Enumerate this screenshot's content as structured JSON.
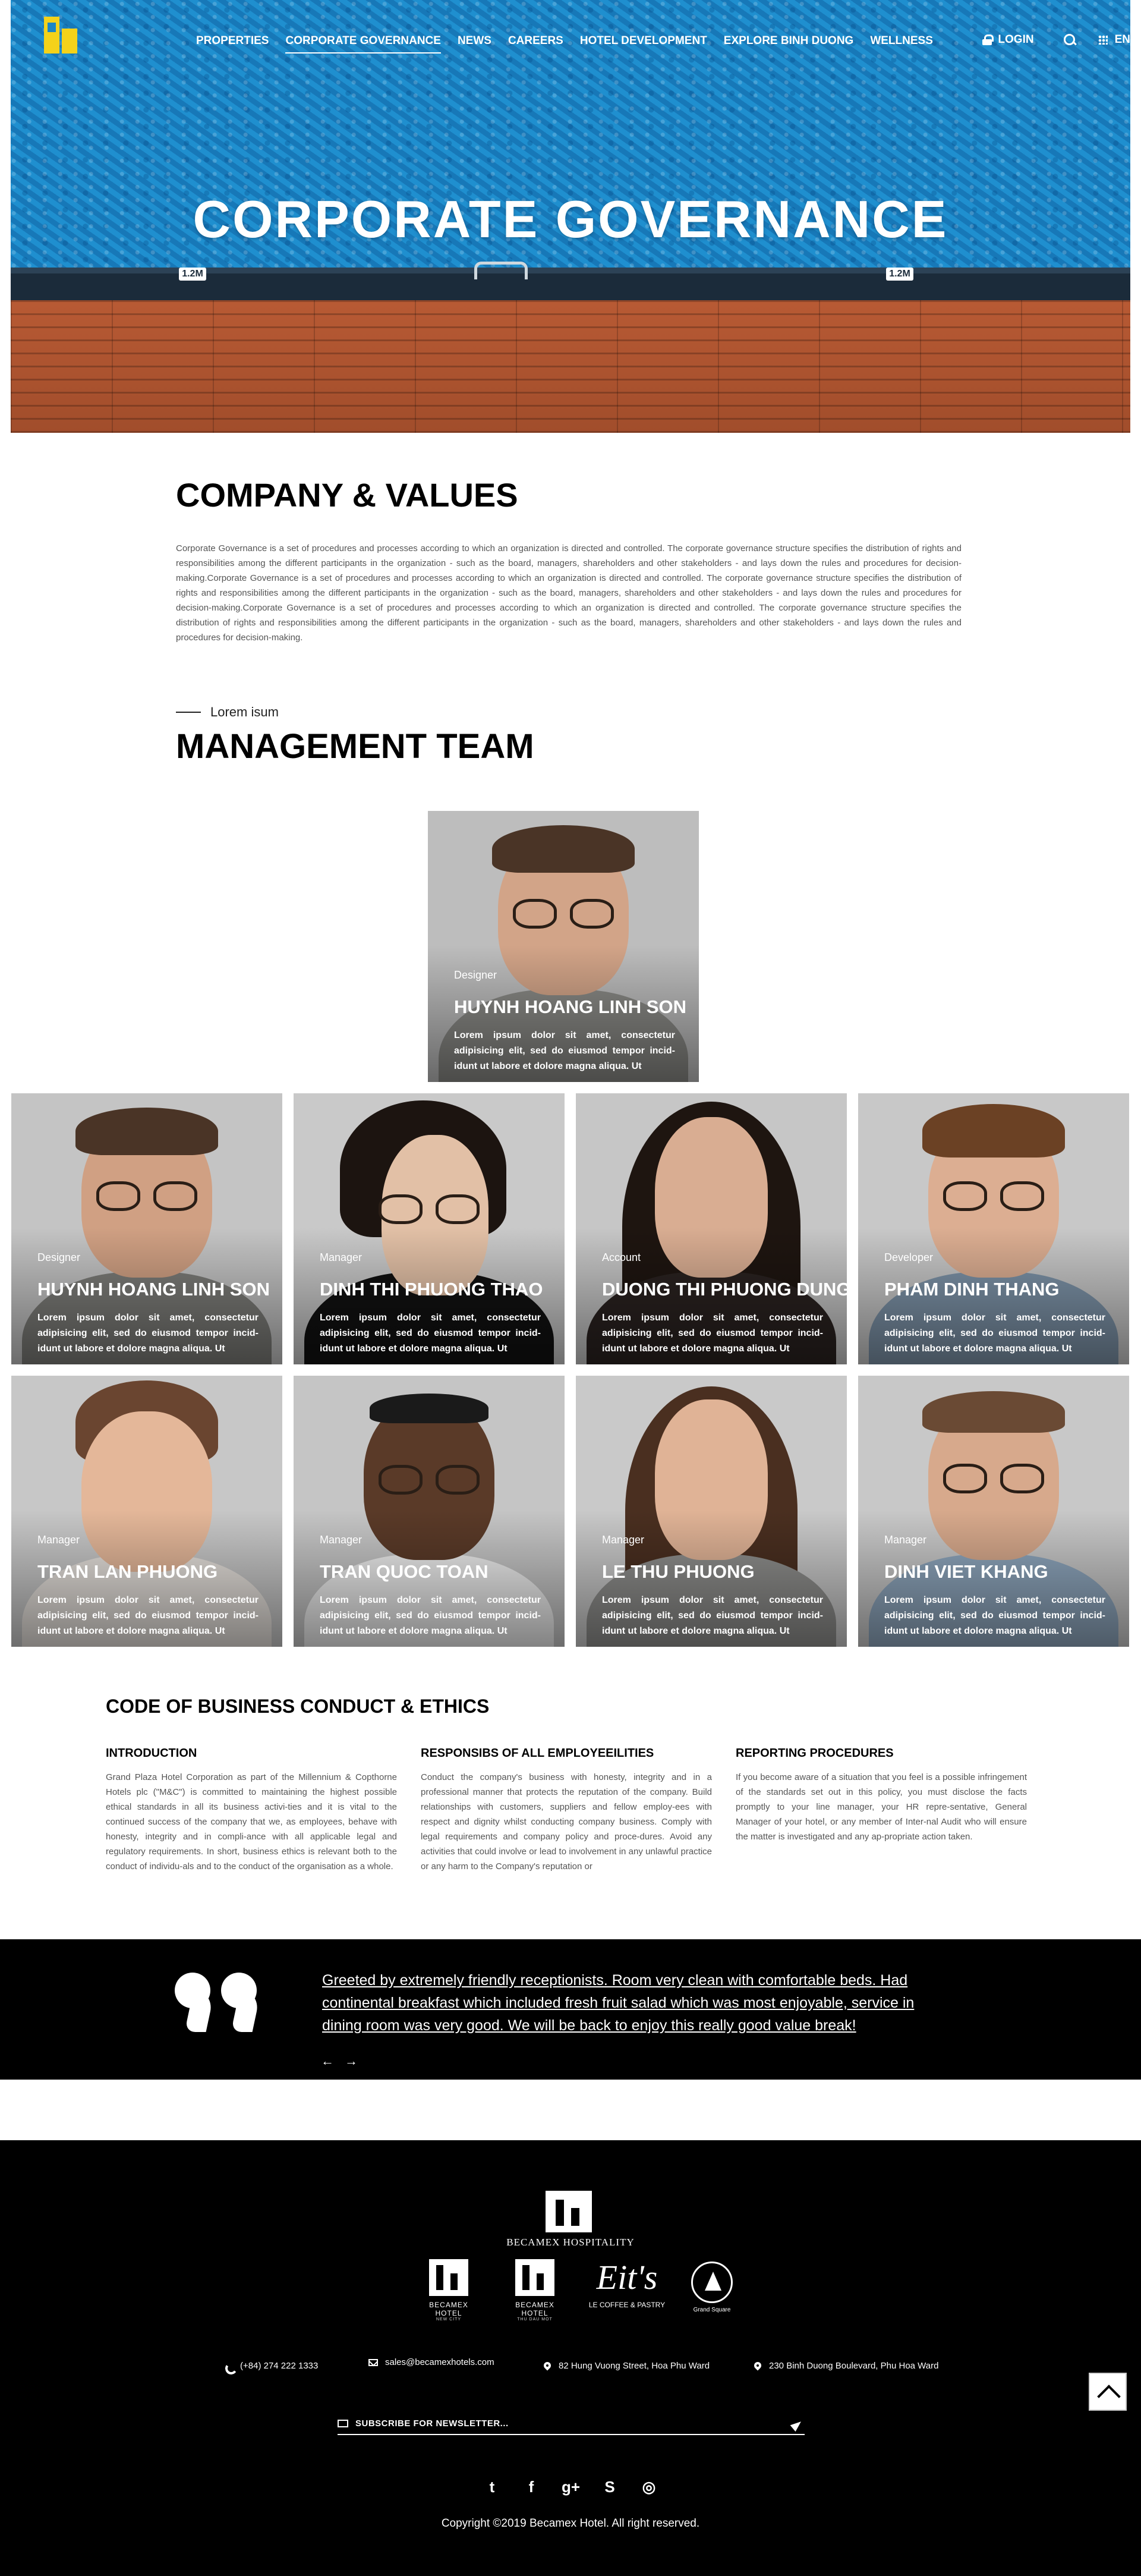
{
  "nav": {
    "items": [
      {
        "label": "PROPERTIES",
        "active": false
      },
      {
        "label": "CORPORATE GOVERNANCE",
        "active": true
      },
      {
        "label": "NEWS",
        "active": false
      },
      {
        "label": "CAREERS",
        "active": false
      },
      {
        "label": "HOTEL DEVELOPMENT",
        "active": false
      },
      {
        "label": "EXPLORE BINH DUONG",
        "active": false
      },
      {
        "label": "WELLNESS",
        "active": false
      }
    ],
    "login": "LOGIN",
    "lang": "EN",
    "icons": [
      "lock-icon",
      "search-icon",
      "grid-icon"
    ]
  },
  "hero": {
    "title": "CORPORATE GOVERNANCE",
    "depth_markers": [
      "1.2M",
      "1.2M"
    ]
  },
  "company": {
    "title": "COMPANY & VALUES",
    "text": "Corporate Governance is a set of procedures and processes according to which an organization is directed and controlled. The corporate governance structure specifies the distribution of rights and responsibilities among the different participants in the organization - such as the board, managers, shareholders and other stakeholders - and lays down the rules and procedures for decision-making.Corporate Governance is a set of procedures and processes according to which an organization is directed and controlled. The corporate governance structure specifies the distribution of rights and responsibilities among the different participants in the organization - such as the board, managers, shareholders and other stakeholders - and lays down the rules and procedures for decision-making.Corporate Governance is a set of procedures and processes according to which an organization is directed and controlled. The corporate governance structure specifies the distribution of rights and responsibilities among the different participants in the organization - such as the board, managers, shareholders and other stakeholders - and lays down the rules and procedures for decision-making."
  },
  "management": {
    "lead": "Lorem isum",
    "title": "MANAGEMENT TEAM",
    "featured": {
      "role": "Designer",
      "name": "HUYNH HOANG LINH SON",
      "desc": "Lorem ipsum dolor sit amet, consectetur adipisicing elit, sed do eiusmod tempor incid-idunt ut labore et dolore magna aliqua. Ut"
    },
    "members": [
      {
        "role": "Designer",
        "name": "HUYNH HOANG LINH SON",
        "desc": "Lorem ipsum dolor sit amet, consectetur adipisicing elit, sed do eiusmod tempor incid-idunt ut labore et dolore magna aliqua. Ut"
      },
      {
        "role": "Manager",
        "name": "DINH THI PHUONG THAO",
        "desc": "Lorem ipsum dolor sit amet, consectetur adipisicing elit, sed do eiusmod tempor incid-idunt ut labore et dolore magna aliqua. Ut"
      },
      {
        "role": "Account",
        "name": "DUONG THI PHUONG DUNG",
        "desc": "Lorem ipsum dolor sit amet, consectetur adipisicing elit, sed do eiusmod tempor incid-idunt ut labore et dolore magna aliqua. Ut"
      },
      {
        "role": "Developer",
        "name": "PHAM DINH THANG",
        "desc": "Lorem ipsum dolor sit amet, consectetur adipisicing elit, sed do eiusmod tempor incid-idunt ut labore et dolore magna aliqua. Ut"
      },
      {
        "role": "Manager",
        "name": "TRAN LAN PHUONG",
        "desc": "Lorem ipsum dolor sit amet, consectetur adipisicing elit, sed do eiusmod tempor incid-idunt ut labore et dolore magna aliqua. Ut"
      },
      {
        "role": "Manager",
        "name": "TRAN QUOC TOAN",
        "desc": "Lorem ipsum dolor sit amet, consectetur adipisicing elit, sed do eiusmod tempor incid-idunt ut labore et dolore magna aliqua. Ut"
      },
      {
        "role": "Manager",
        "name": "LE THU PHUONG",
        "desc": "Lorem ipsum dolor sit amet, consectetur adipisicing elit, sed do eiusmod tempor incid-idunt ut labore et dolore magna aliqua. Ut"
      },
      {
        "role": "Manager",
        "name": "DINH VIET KHANG",
        "desc": "Lorem ipsum dolor sit amet, consectetur adipisicing elit, sed do eiusmod tempor incid-idunt ut labore et dolore magna aliqua. Ut"
      }
    ]
  },
  "code": {
    "title": "CODE OF BUSINESS CONDUCT & ETHICS",
    "columns": [
      {
        "heading": "INTRODUCTION",
        "text": "Grand Plaza Hotel Corporation as part of the Millennium & Copthorne Hotels plc (\"M&C\") is committed to maintaining the highest possible ethical standards in all its business activi-ties and it is vital to the continued success of the company that we, as employees, behave with honesty, integrity and in compli-ance with all applicable legal and regulatory requirements. In short, business ethics is relevant both to the conduct of individu-als and to the conduct of the organisation as a whole."
      },
      {
        "heading": "RESPONSIBS OF ALL EMPLOYEEILITIES",
        "text": "Conduct the company's business with honesty, integrity and in a professional manner that protects the reputation of the company. Build relationships with customers, suppliers and fellow employ-ees with respect and dignity whilst conducting company business. Comply with legal requirements and company policy and proce-dures. Avoid any activities that could involve or lead to involvement in any unlawful practice or any harm to the Company's reputation or"
      },
      {
        "heading": "REPORTING PROCEDURES",
        "text": "If you become aware of a situation that you feel is a possible infringement of the standards set out in this policy, you must disclose the facts promptly to your line manager, your HR repre-sentative, General Manager of your hotel, or any member of Inter-nal Audit who will ensure the matter is investigated and any ap-propriate action taken."
      }
    ]
  },
  "testimonial": {
    "quote": "Greeted by extremely friendly receptionists. Room very clean with comfortable beds. Had continental breakfast which included fresh fruit salad which was most enjoyable, service in dining room was very good. We will be back to enjoy this really good value break!",
    "prev": "←",
    "next": "→"
  },
  "footer": {
    "brand": "BECAMEX HOSPITALITY",
    "sub_brands": [
      {
        "name": "BECAMEX HOTEL",
        "sub": "NEW CITY"
      },
      {
        "name": "BECAMEX HOTEL",
        "sub": "THU DAU MOT"
      },
      {
        "name": "LE COFFEE & PASTRY",
        "script": "Eit's"
      },
      {
        "name": "Grand Square",
        "sub": ""
      }
    ],
    "contacts": [
      {
        "icon": "phone-icon",
        "text": "(+84) 274 222 1333"
      },
      {
        "icon": "mail-icon",
        "text": "sales@becamexhotels.com"
      },
      {
        "icon": "pin-icon",
        "text": "82 Hung Vuong Street, Hoa Phu Ward"
      },
      {
        "icon": "pin-icon",
        "text": "230 Binh Duong Boulevard, Phu Hoa Ward"
      }
    ],
    "newsletter": "SUBSCRIBE FOR NEWSLETTER...",
    "socials": [
      "twitter-icon",
      "facebook-icon",
      "google-plus-icon",
      "skype-icon",
      "instagram-icon"
    ],
    "social_glyphs": [
      "t",
      "f",
      "g+",
      "S",
      "◎"
    ],
    "copyright": "Copyright ©2019 Becamex Hotel. All right reserved."
  },
  "colors": {
    "accent": "#f4d21a",
    "pool": "#1c86c5",
    "deck": "#b05530",
    "dark": "#000000"
  }
}
